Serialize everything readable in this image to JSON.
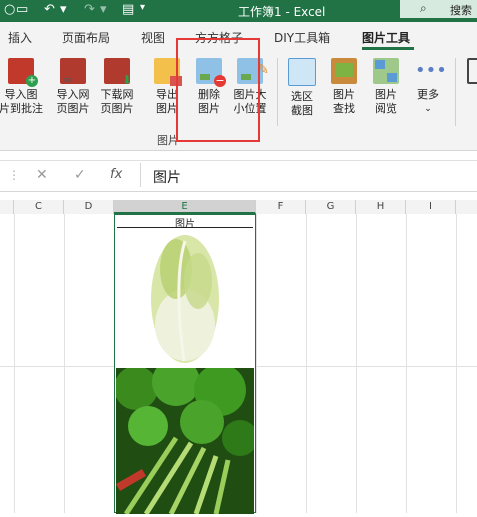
{
  "titlebar": {
    "title": "工作簿1 - Excel",
    "search_label": "搜索"
  },
  "tabs": [
    "插入",
    "页面布局",
    "视图",
    "方方格子",
    "DIY工具箱",
    "图片工具"
  ],
  "ribbon": {
    "buttons": [
      {
        "label": "导入图\n片到批注",
        "icon": "import-to-comment-icon"
      },
      {
        "label": "导入网\n页图片",
        "icon": "import-web-image-icon"
      },
      {
        "label": "下载网\n页图片",
        "icon": "download-web-image-icon"
      },
      {
        "label": "导出\n图片",
        "icon": "export-image-icon"
      },
      {
        "label": "删除\n图片",
        "icon": "delete-image-icon"
      },
      {
        "label": "图片大\n小位置",
        "icon": "image-size-position-icon"
      },
      {
        "label": "选区\n截图",
        "icon": "selection-screenshot-icon"
      },
      {
        "label": "图片\n查找",
        "icon": "image-find-icon"
      },
      {
        "label": "图片\n阅览",
        "icon": "image-browse-icon"
      },
      {
        "label": "更多",
        "icon": "more-icon"
      }
    ],
    "group_label": "图片"
  },
  "formula_bar": {
    "value": "图片",
    "fx": "fx"
  },
  "columns": [
    "C",
    "D",
    "E",
    "F",
    "G",
    "H",
    "I"
  ],
  "selected_column": "E",
  "cell": {
    "header_text": "图片"
  },
  "colors": {
    "accent": "#217346",
    "highlight": "#e53935"
  }
}
